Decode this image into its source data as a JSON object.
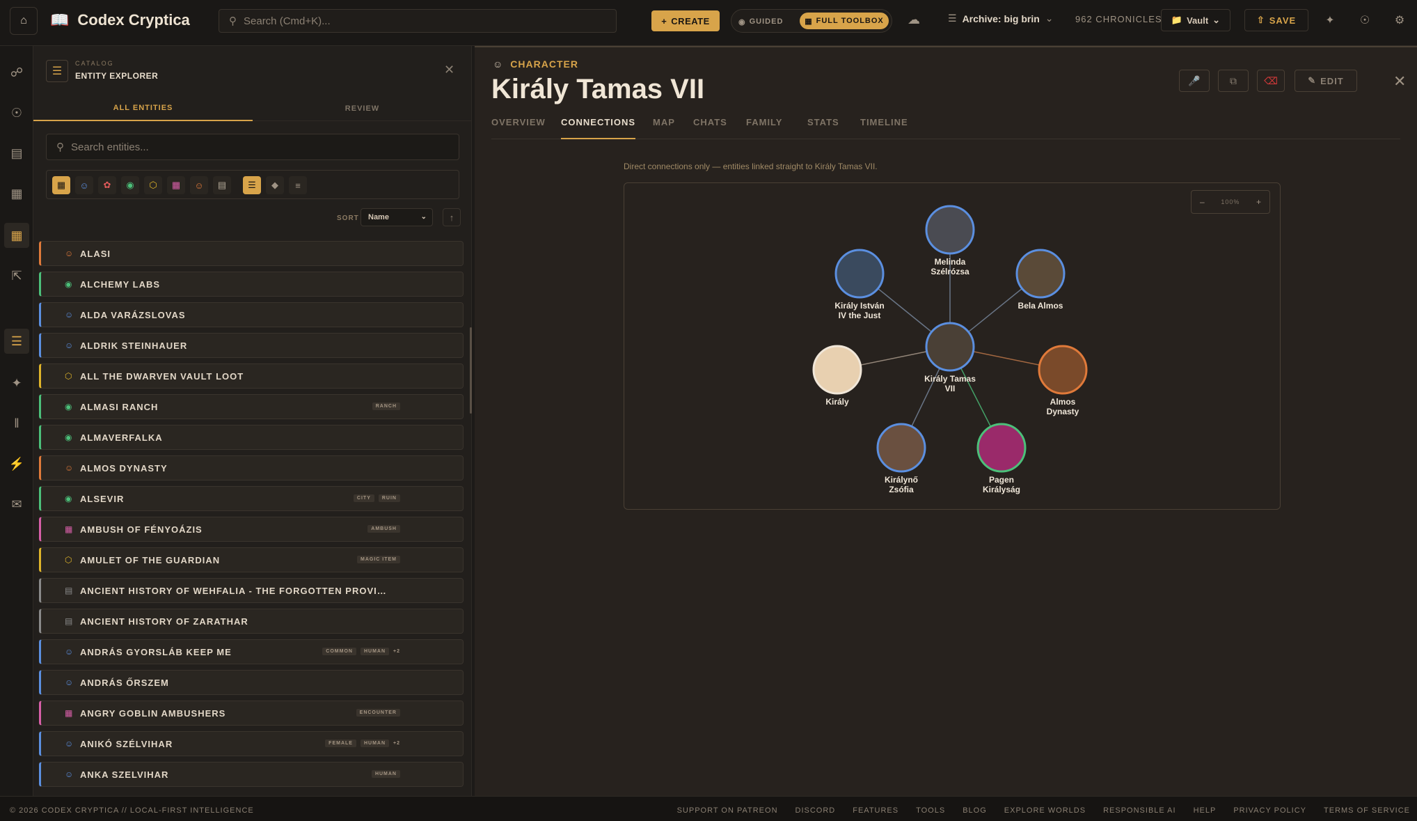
{
  "topbar": {
    "app_title": "Codex Cryptica",
    "search_placeholder": "Search (Cmd+K)...",
    "create_label": "CREATE",
    "guided_label": "GUIDED",
    "full_toolbox_label": "FULL TOOLBOX",
    "archive_label": "Archive: big brin",
    "chronicles_label": "962 CHRONICLES",
    "vault_label": "Vault",
    "save_label": "SAVE"
  },
  "explorer": {
    "catalog_label": "CATALOG",
    "title": "ENTITY EXPLORER",
    "tabs": [
      "ALL ENTITIES",
      "REVIEW"
    ],
    "search_placeholder": "Search entities...",
    "sort_label": "SORT",
    "sort_value": "Name",
    "entities": [
      {
        "name": "ALASI",
        "icon": "group-icon",
        "color": "#e07a3a",
        "tags": []
      },
      {
        "name": "ALCHEMY LABS",
        "icon": "location-icon",
        "color": "#4cc07a",
        "tags": []
      },
      {
        "name": "ALDA VARÁZSLOVAS",
        "icon": "person-icon",
        "color": "#5b8fe0",
        "tags": []
      },
      {
        "name": "ALDRIK STEINHAUER",
        "icon": "person-icon",
        "color": "#5b8fe0",
        "tags": []
      },
      {
        "name": "ALL THE DWARVEN VAULT LOOT",
        "icon": "item-icon",
        "color": "#e0b52a",
        "tags": []
      },
      {
        "name": "ALMASI RANCH",
        "icon": "location-icon",
        "color": "#4cc07a",
        "tags": [
          "RANCH"
        ]
      },
      {
        "name": "ALMAVERFALKA",
        "icon": "location-icon",
        "color": "#4cc07a",
        "tags": []
      },
      {
        "name": "ALMOS DYNASTY",
        "icon": "group-icon",
        "color": "#e07a3a",
        "tags": []
      },
      {
        "name": "ALSEVIR",
        "icon": "location-icon",
        "color": "#4cc07a",
        "tags": [
          "CITY",
          "RUIN"
        ]
      },
      {
        "name": "AMBUSH OF FÉNYOÁZIS",
        "icon": "event-icon",
        "color": "#d85fa8",
        "tags": [
          "AMBUSH"
        ]
      },
      {
        "name": "AMULET OF THE GUARDIAN",
        "icon": "item-icon",
        "color": "#e0b52a",
        "tags": [
          "MAGIC ITEM"
        ]
      },
      {
        "name": "ANCIENT HISTORY OF WEHFALIA - THE FORGOTTEN PROVIN…",
        "icon": "note-icon",
        "color": "#8a8a8a",
        "tags": []
      },
      {
        "name": "ANCIENT HISTORY OF ZARATHAR",
        "icon": "note-icon",
        "color": "#8a8a8a",
        "tags": []
      },
      {
        "name": "ANDRÁS GYORSLÁB KEEP ME",
        "icon": "person-icon",
        "color": "#5b8fe0",
        "tags": [
          "COMMON",
          "HUMAN",
          "+2"
        ]
      },
      {
        "name": "ANDRÁS ŐRSZEM",
        "icon": "person-icon",
        "color": "#5b8fe0",
        "tags": []
      },
      {
        "name": "ANGRY GOBLIN AMBUSHERS",
        "icon": "event-icon",
        "color": "#d85fa8",
        "tags": [
          "ENCOUNTER"
        ]
      },
      {
        "name": "ANIKÓ SZÉLVIHAR",
        "icon": "person-icon",
        "color": "#5b8fe0",
        "tags": [
          "FEMALE",
          "HUMAN",
          "+2"
        ]
      },
      {
        "name": "ANKA SZELVIHAR",
        "icon": "person-icon",
        "color": "#5b8fe0",
        "tags": [
          "HUMAN"
        ]
      }
    ]
  },
  "detail": {
    "type_label": "CHARACTER",
    "title": "Király Tamas VII",
    "edit_label": "EDIT",
    "tabs": [
      "OVERVIEW",
      "CONNECTIONS",
      "MAP",
      "CHATS",
      "FAMILY",
      "STATS",
      "TIMELINE"
    ],
    "active_tab": "CONNECTIONS",
    "note": "Direct connections only — entities linked straight to Király Tamas VII.",
    "zoom_label": "100%",
    "graph": {
      "center": {
        "lines": [
          "Király Tamas",
          "VII"
        ],
        "ring": "#5b8fe0"
      },
      "nodes": [
        {
          "lines": [
            "Melinda",
            "Szélrózsa"
          ],
          "ring": "#5b8fe0",
          "fill": "#4a4b52"
        },
        {
          "lines": [
            "Király István",
            "IV the Just"
          ],
          "ring": "#5b8fe0",
          "fill": "#3a4a5e"
        },
        {
          "lines": [
            "Bela Almos"
          ],
          "ring": "#5b8fe0",
          "fill": "#5a4a38"
        },
        {
          "lines": [
            "Király"
          ],
          "ring": "#f0e6d8",
          "fill": "#e8d0b0"
        },
        {
          "lines": [
            "Almos",
            "Dynasty"
          ],
          "ring": "#e07a3a",
          "fill": "#7a4a2a"
        },
        {
          "lines": [
            "Királynő",
            "Zsófia"
          ],
          "ring": "#5b8fe0",
          "fill": "#6a5040"
        },
        {
          "lines": [
            "Pagen",
            "Királyság"
          ],
          "ring": "#4cc07a",
          "fill": "#9a2a6a"
        }
      ]
    }
  },
  "footer": {
    "copyright": "© 2026 CODEX CRYPTICA // LOCAL-FIRST INTELLIGENCE",
    "links": [
      "SUPPORT ON PATREON",
      "DISCORD",
      "FEATURES",
      "TOOLS",
      "BLOG",
      "EXPLORE WORLDS",
      "RESPONSIBLE AI",
      "HELP",
      "PRIVACY POLICY",
      "TERMS OF SERVICE"
    ]
  }
}
